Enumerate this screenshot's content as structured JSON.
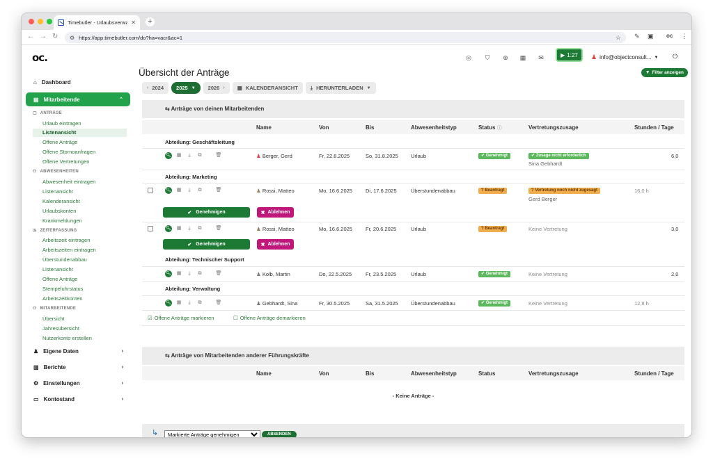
{
  "browser": {
    "tab_title": "Timebutler - Urlaubsverwaltu",
    "url": "https://app.timebutler.com/do?ha=vacr&ac=1"
  },
  "header": {
    "logo": "oc.",
    "timer": "1:27",
    "user": "info@objectconsult..."
  },
  "sidebar": {
    "dashboard": "Dashboard",
    "mitarbeitende": "Mitarbeitende",
    "sections": {
      "antraege": "ANTRÄGE",
      "abwesenheiten": "ABWESENHEITEN",
      "zeiterfassung": "ZEITERFASSUNG",
      "mitarbeitende": "MITARBEITENDE"
    },
    "antraege_links": [
      "Urlaub eintragen",
      "Listenansicht",
      "Offene Anträge",
      "Offene Stornoanfragen",
      "Offene Vertretungen"
    ],
    "abwesenheiten_links": [
      "Abwesenheit eintragen",
      "Listenansicht",
      "Kalenderansicht",
      "Urlaubskonten",
      "Krankmeldungen"
    ],
    "zeiterfassung_links": [
      "Arbeitszeit eintragen",
      "Arbeitszeiten eintragen",
      "Überstundenabbau",
      "Listenansicht",
      "Offene Anträge",
      "Stempeluhrstatus",
      "Arbeitszeitkonten"
    ],
    "mitarbeitende_links": [
      "Übersicht",
      "Jahresübersicht",
      "Nutzerkonto erstellen"
    ],
    "bottom_items": [
      "Eigene Daten",
      "Berichte",
      "Einstellungen",
      "Kontostand"
    ]
  },
  "main": {
    "title": "Übersicht der Anträge",
    "filter": "Filter anzeigen",
    "years": {
      "prev": "2024",
      "current": "2025",
      "next": "2026"
    },
    "calendar_view": "KALENDERANSICHT",
    "download": "HERUNTERLADEN",
    "columns": [
      "Name",
      "Von",
      "Bis",
      "Abwesenheitstyp",
      "Status",
      "Vertretungszusage",
      "Stunden / Tage"
    ],
    "panel1_title": "Anträge von deinen Mitarbeitenden",
    "panel2_title": "Anträge von Mitarbeitenden anderer Führungskräfte",
    "departments": {
      "d1": "Abteilung: Geschäftsleitung",
      "d2": "Abteilung: Marketing",
      "d3": "Abteilung: Technischer Support",
      "d4": "Abteilung: Verwaltung"
    },
    "rows": [
      {
        "name": "Berger, Gerd",
        "von": "Fr, 22.8.2025",
        "bis": "So, 31.8.2025",
        "typ": "Urlaub",
        "status": "Genehmigt",
        "vertretung": "Zusage nicht erforderlich",
        "vertreter": "Sina Gebhardt",
        "wert": "6,0"
      },
      {
        "name": "Rossi, Matteo",
        "von": "Mo, 16.6.2025",
        "bis": "Di, 17.6.2025",
        "typ": "Überstundenabbau",
        "status": "? Beantragt",
        "vertretung": "? Vertretung noch nicht zugesagt",
        "vertreter": "Gerd Berger",
        "wert": "16,0 h"
      },
      {
        "name": "Rossi, Matteo",
        "von": "Mo, 16.6.2025",
        "bis": "Fr, 20.6.2025",
        "typ": "Urlaub",
        "status": "? Beantragt",
        "vertretung": "Keine Vertretung",
        "wert": "3,0"
      },
      {
        "name": "Kolb, Martin",
        "von": "Do, 22.5.2025",
        "bis": "Fr, 23.5.2025",
        "typ": "Urlaub",
        "status": "Genehmigt",
        "vertretung": "Keine Vertretung",
        "wert": "2,0"
      },
      {
        "name": "Gebhardt, Sina",
        "von": "Fr, 30.5.2025",
        "bis": "Sa, 31.5.2025",
        "typ": "Überstundenabbau",
        "status": "Genehmigt",
        "vertretung": "Keine Vertretung",
        "wert": "12,8 h"
      }
    ],
    "approve": "Genehmigen",
    "reject": "Ablehnen",
    "mark_open": "Offene Anträge markieren",
    "unmark_open": "Offene Anträge demarkieren",
    "no_requests": "- Keine Anträge -",
    "bulk_select": "Markierte Anträge genehmigen",
    "send": "ABSENDEN"
  },
  "colors": {
    "accent": "#22a24a",
    "dark_green": "#1c7a35",
    "reject": "#c0177a",
    "ok": "#5cb85c",
    "warn": "#f0ad4e"
  }
}
